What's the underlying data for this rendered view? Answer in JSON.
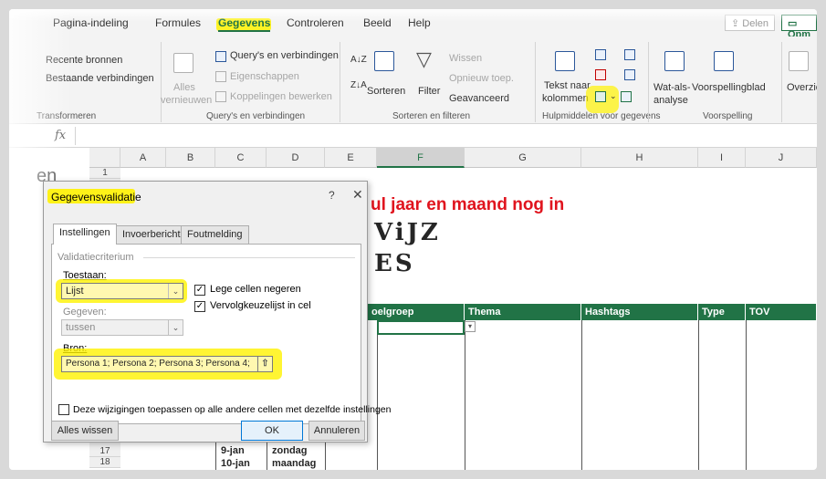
{
  "tabs": [
    "Pagina-indeling",
    "Formules",
    "Gegevens",
    "Controleren",
    "Beeld",
    "Help"
  ],
  "active_tab": "Gegevens",
  "top_buttons": {
    "delen": "Delen",
    "opm": "Opm"
  },
  "ribbon": {
    "recent": "Recente bronnen",
    "bestaande": "Bestaande verbindingen",
    "transformeren": "Transformeren",
    "alles": "Alles",
    "vernieuwen": "vernieuwen",
    "queries": "Query's en verbindingen",
    "eigenschappen": "Eigenschappen",
    "koppelingen": "Koppelingen bewerken",
    "group_queries": "Query's en verbindingen",
    "sorteren": "Sorteren",
    "filter": "Filter",
    "wissen": "Wissen",
    "opnieuw": "Opnieuw toep.",
    "geavanceerd": "Geavanceerd",
    "group_sort": "Sorteren en filteren",
    "tekst_naar": "Tekst naar",
    "kolommen": "kolommen",
    "group_hulp": "Hulpmiddelen voor gegevens",
    "watals": "Wat-als-",
    "analyse": "analyse",
    "voorspellingblad": "Voorspellingblad",
    "group_voorspelling": "Voorspelling",
    "overzicht": "Overzicht"
  },
  "formula_bar": {
    "fx": "fx"
  },
  "grid": {
    "columns": [
      "A",
      "B",
      "C",
      "D",
      "E",
      "F",
      "G",
      "H",
      "I",
      "J"
    ],
    "rows": [
      "1",
      "17",
      "18"
    ],
    "left_fragment": "en",
    "title_line": "ul jaar en maand nog in",
    "line2": "ViJZ",
    "line3": "ES",
    "headers": [
      "oelgroep",
      "Thema",
      "Hashtags",
      "Type",
      "TOV"
    ],
    "date1": "9-jan",
    "day1": "zondag",
    "date2": "10-jan",
    "day2": "maandag"
  },
  "dialog": {
    "title": "Gegevensvalidatie",
    "help": "?",
    "close": "✕",
    "tabs": [
      "Instellingen",
      "Invoerbericht",
      "Foutmelding"
    ],
    "criterium": "Validatiecriterium",
    "toestaan_label": "Toestaan:",
    "toestaan_value": "Lijst",
    "gegeven_label": "Gegeven:",
    "gegeven_value": "tussen",
    "lege_cellen": "Lege cellen negeren",
    "vervolgkeuzelijst": "Vervolgkeuzelijst in cel",
    "bron_label": "Bron:",
    "bron_value": "Persona 1; Persona 2; Persona 3; Persona 4;",
    "apply_all": "Deze wijzigingen toepassen op alle andere cellen met dezelfde instellingen",
    "clear_btn": "Alles wissen",
    "ok_btn": "OK",
    "cancel_btn": "Annuleren"
  },
  "colors": {
    "excel_green": "#217346",
    "highlight": "#fff200",
    "title_red": "#e0141e"
  }
}
